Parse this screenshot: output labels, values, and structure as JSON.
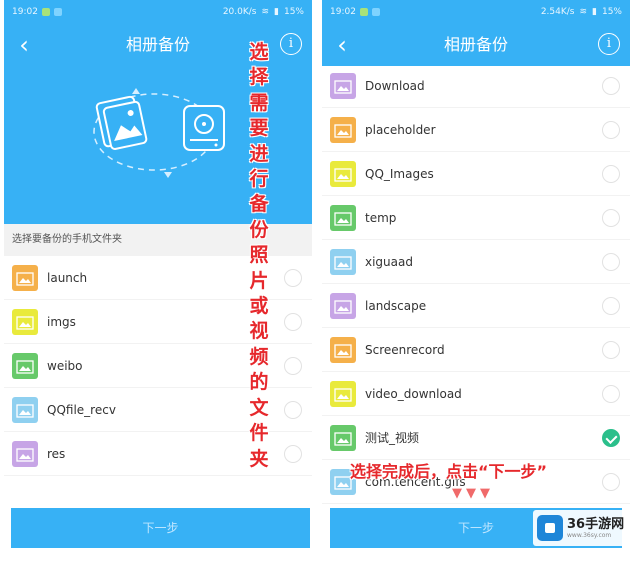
{
  "left": {
    "status": {
      "time": "19:02",
      "speed": "20.0K/s",
      "battery": "15%"
    },
    "title": "相册备份",
    "section_label": "选择要备份的手机文件夹",
    "folders": [
      {
        "name": "launch",
        "color": "#f5b04a",
        "checked": false
      },
      {
        "name": "imgs",
        "color": "#e9ea3c",
        "checked": false
      },
      {
        "name": "weibo",
        "color": "#67c96a",
        "checked": false
      },
      {
        "name": "QQfile_recv",
        "color": "#8fd0f0",
        "checked": false
      },
      {
        "name": "res",
        "color": "#c7a5e6",
        "checked": false
      }
    ],
    "next_label": "下一步"
  },
  "right": {
    "status": {
      "time": "19:02",
      "speed": "2.54K/s",
      "battery": "15%"
    },
    "title": "相册备份",
    "folders": [
      {
        "name": "Download",
        "color": "#c7a5e6",
        "checked": false
      },
      {
        "name": "placeholder",
        "color": "#f5b04a",
        "checked": false
      },
      {
        "name": "QQ_Images",
        "color": "#e9ea3c",
        "checked": false
      },
      {
        "name": "temp",
        "color": "#67c96a",
        "checked": false
      },
      {
        "name": "xiguaad",
        "color": "#8fd0f0",
        "checked": false
      },
      {
        "name": "landscape",
        "color": "#c7a5e6",
        "checked": false
      },
      {
        "name": "Screenrecord",
        "color": "#f5b04a",
        "checked": false
      },
      {
        "name": "video_download",
        "color": "#e9ea3c",
        "checked": false
      },
      {
        "name": "测试_视频",
        "color": "#67c96a",
        "checked": true
      },
      {
        "name": "com.tencent.gifs",
        "color": "#8fd0f0",
        "checked": false
      }
    ],
    "next_label": "下一步"
  },
  "captions": {
    "vertical": "选择需要进行备份照片或视频的文件夹",
    "overlay": "选择完成后，点击“下一步”",
    "arrows": "▼▼▼"
  },
  "watermark": {
    "title": "36手游网",
    "url": "www.36sy.com"
  },
  "colors": {
    "primary": "#37b1f5",
    "check_on": "#2bbf8b",
    "caption": "#e6282c"
  }
}
